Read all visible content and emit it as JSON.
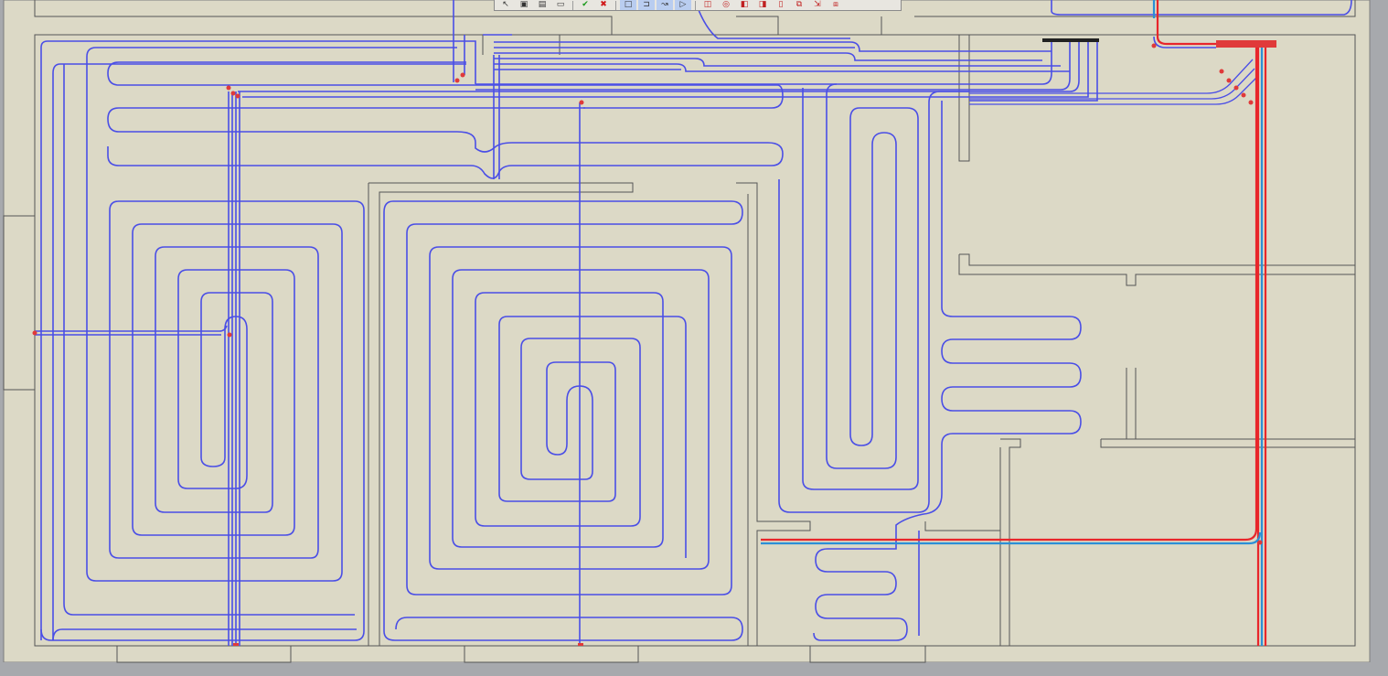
{
  "app": {
    "title": ""
  },
  "colors": {
    "background": "#dcd9c6",
    "outer": "#a7a9ad",
    "wall": "#505050",
    "pipe": "#4a4ee6",
    "supply": "#e8262b",
    "return": "#2b8fd6",
    "marker": "#e03a3a"
  },
  "toolbar": {
    "buttons": [
      {
        "name": "pointer-icon",
        "glyph": "↖"
      },
      {
        "name": "floppy-icon",
        "glyph": "▣"
      },
      {
        "name": "clipboard-icon",
        "glyph": "▤"
      },
      {
        "name": "ruler-icon",
        "glyph": "▭"
      },
      {
        "name": "confirm-icon",
        "glyph": "✔"
      },
      {
        "name": "cancel-icon",
        "glyph": "✖"
      },
      {
        "name": "select-rect-icon",
        "glyph": "□"
      },
      {
        "name": "polyline-icon",
        "glyph": "⊐"
      },
      {
        "name": "route-icon",
        "glyph": "↝"
      },
      {
        "name": "triangle-icon",
        "glyph": "▷"
      },
      {
        "name": "circuit-add-icon",
        "glyph": "◫"
      },
      {
        "name": "circuit-spiral-icon",
        "glyph": "◎"
      },
      {
        "name": "layer-icon",
        "glyph": "◧"
      },
      {
        "name": "layer-alt-icon",
        "glyph": "◨"
      },
      {
        "name": "page-icon",
        "glyph": "▯"
      },
      {
        "name": "copy-icon",
        "glyph": "⧉"
      },
      {
        "name": "export-icon",
        "glyph": "⇲"
      },
      {
        "name": "manifold-icon",
        "glyph": "⧈"
      }
    ]
  }
}
